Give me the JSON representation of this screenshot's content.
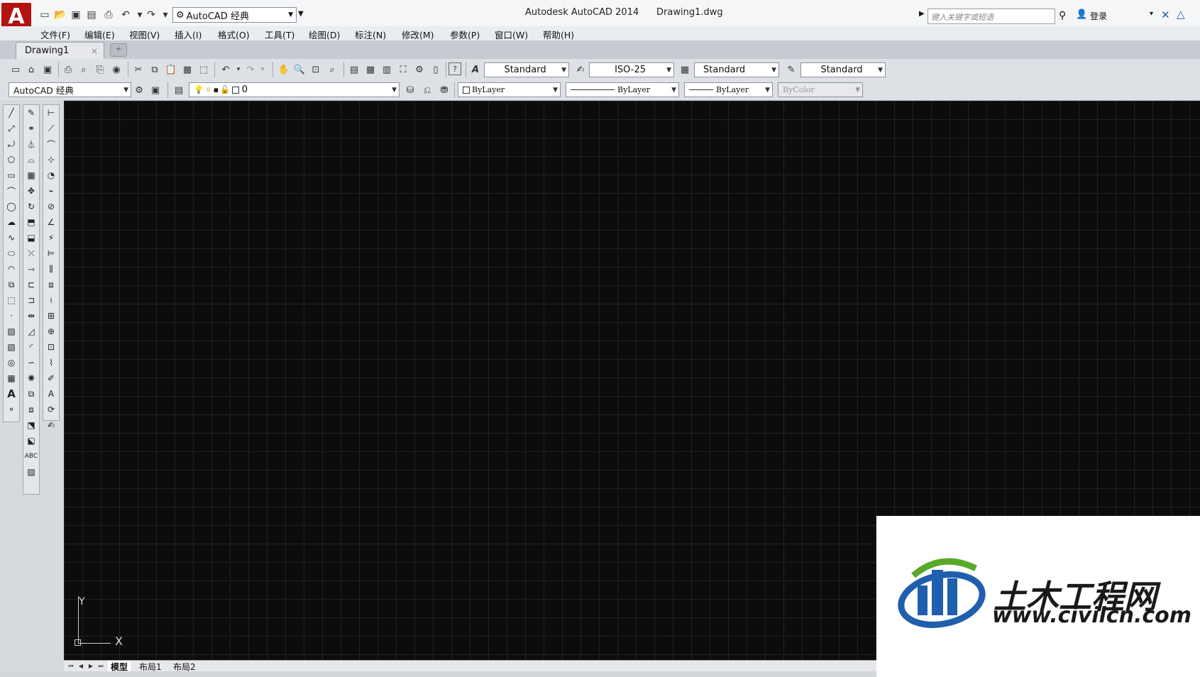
{
  "app": {
    "logo_letter": "A",
    "title": "Autodesk AutoCAD 2014      Drawing1.dwg",
    "workspace": "AutoCAD 经典",
    "search_placeholder": "键入关键字或短语",
    "login": "登录"
  },
  "menu": [
    "文件(F)",
    "编辑(E)",
    "视图(V)",
    "插入(I)",
    "格式(O)",
    "工具(T)",
    "绘图(D)",
    "标注(N)",
    "修改(M)",
    "参数(P)",
    "窗口(W)",
    "帮助(H)"
  ],
  "tabs": {
    "doc": "Drawing1",
    "close": "×"
  },
  "styles": {
    "text_style": "Standard",
    "dim_style": "ISO-25",
    "table_style": "Standard",
    "mleader_style": "Standard"
  },
  "layers": {
    "workspace": "AutoCAD 经典",
    "current_layer": "0",
    "color": "ByLayer",
    "linetype": "ByLayer",
    "lineweight": "ByLayer",
    "plotstyle": "ByColor"
  },
  "ucs": {
    "y": "Y",
    "x": "X"
  },
  "layout_tabs": [
    "模型",
    "布局1",
    "布局2"
  ],
  "watermark": {
    "cn": "土木工程网",
    "url": "www.civilcn.com"
  },
  "colors": {
    "canvas": "#0c0c0c",
    "grid": "#222222",
    "logo": "#b3120e",
    "watermark_blue": "#1f5fae",
    "watermark_green": "#5aa82a"
  }
}
